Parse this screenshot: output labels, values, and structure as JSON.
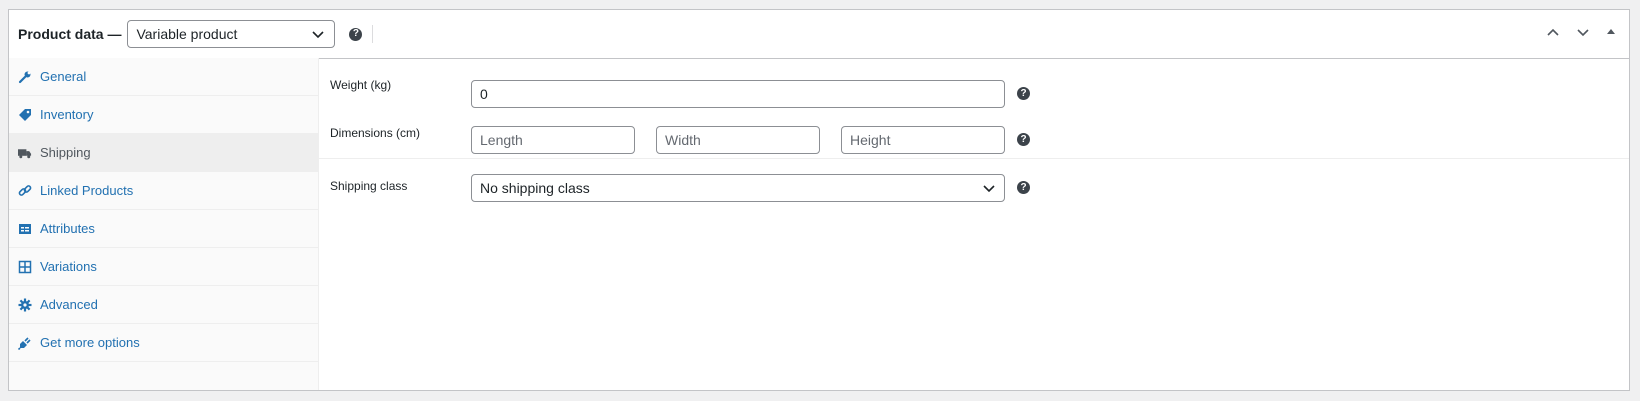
{
  "header": {
    "title": "Product data —",
    "product_type": "Variable product",
    "help": "?"
  },
  "sidebar": {
    "items": [
      {
        "label": "General",
        "icon": "wrench-icon",
        "active": false
      },
      {
        "label": "Inventory",
        "icon": "tag-icon",
        "active": false
      },
      {
        "label": "Shipping",
        "icon": "truck-icon",
        "active": true
      },
      {
        "label": "Linked Products",
        "icon": "link-icon",
        "active": false
      },
      {
        "label": "Attributes",
        "icon": "list-card-icon",
        "active": false
      },
      {
        "label": "Variations",
        "icon": "grid-icon",
        "active": false
      },
      {
        "label": "Advanced",
        "icon": "gear-icon",
        "active": false
      },
      {
        "label": "Get more options",
        "icon": "plug-icon",
        "active": false
      }
    ]
  },
  "shipping": {
    "weight": {
      "label": "Weight (kg)",
      "value": "0"
    },
    "dimensions": {
      "label": "Dimensions (cm)",
      "length_placeholder": "Length",
      "width_placeholder": "Width",
      "height_placeholder": "Height"
    },
    "shipping_class": {
      "label": "Shipping class",
      "value": "No shipping class"
    }
  },
  "colors": {
    "link": "#2271b1",
    "active_tab_bg": "#eeeeee",
    "border": "#c3c4c7"
  }
}
